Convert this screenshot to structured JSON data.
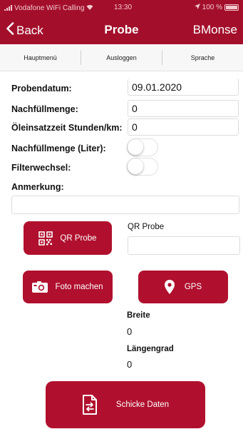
{
  "status_bar": {
    "carrier": "Vodafone WiFi Calling",
    "time": "13:30",
    "battery": "100 %"
  },
  "nav": {
    "back_label": "Back",
    "title": "Probe",
    "right_label": "BMonse"
  },
  "menu": {
    "items": [
      "Hauptmenü",
      "Ausloggen",
      "Sprache"
    ]
  },
  "form": {
    "probendatum_label": "Probendatum:",
    "probendatum_value": "09.01.2020",
    "nachfuellmenge_label": "Nachfüllmenge:",
    "nachfuellmenge_value": "0",
    "oeleinsatzzeit_label": "Öleinsatzzeit Stunden/km:",
    "oeleinsatzzeit_value": "0",
    "nachfuellmenge_liter_label": "Nachfüllmenge (Liter):",
    "nachfuellmenge_liter_on": false,
    "filterwechsel_label": "Filterwechsel:",
    "filterwechsel_on": false,
    "anmerkung_label": "Anmerkung:",
    "anmerkung_value": ""
  },
  "qr": {
    "button_label": "QR Probe",
    "field_label": "QR Probe",
    "field_value": ""
  },
  "foto": {
    "button_label": "Foto machen"
  },
  "gps": {
    "button_label": "GPS",
    "breite_label": "Breite",
    "breite_value": "0",
    "laengengrad_label": "Längengrad",
    "laengengrad_value": "0"
  },
  "send": {
    "button_label": "Schicke Daten"
  },
  "colors": {
    "brand": "#a30f2b",
    "button": "#b0102e"
  }
}
